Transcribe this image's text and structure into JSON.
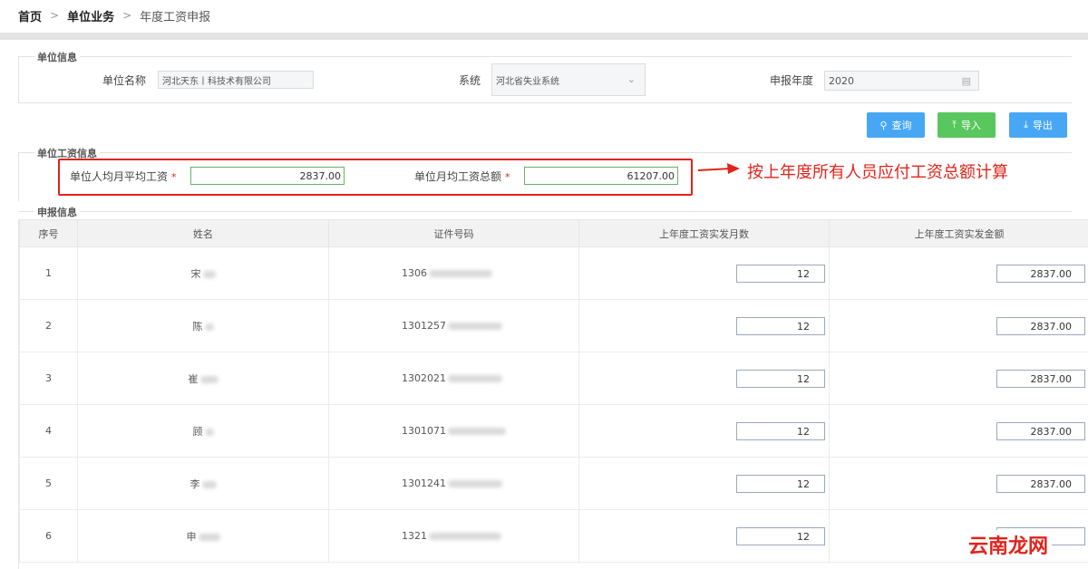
{
  "breadcrumb": {
    "home": "首页",
    "section": "单位业务",
    "current": "年度工资申报",
    "separator": ">"
  },
  "unit_info": {
    "title": "单位信息",
    "name_label": "单位名称",
    "name_value": "河北天东丨科技术有限公司",
    "system_label": "系统",
    "system_value": "河北省失业系统",
    "year_label": "申报年度",
    "year_value": "2020"
  },
  "toolbar": {
    "query_label": "查询",
    "import_label": "导入",
    "export_label": "导出",
    "colors": {
      "query": "#47a7f5",
      "import": "#58c75d",
      "export": "#47a7f5"
    }
  },
  "wage_info": {
    "title": "单位工资信息",
    "avg_label": "单位人均月平均工资",
    "avg_value": "2837.00",
    "total_label": "单位月均工资总额",
    "total_value": "61207.00",
    "required_mark": "*",
    "annotation": "按上年度所有人员应付工资总额计算",
    "annotation_color": "#e2231a"
  },
  "report_info": {
    "title": "申报信息",
    "columns": [
      "序号",
      "姓名",
      "证件号码",
      "上年度工资实发月数",
      "上年度工资实发金额"
    ],
    "rows": [
      {
        "no": "1",
        "name": "宋",
        "id": "1306",
        "months": "12",
        "amount": "2837.00"
      },
      {
        "no": "2",
        "name": "陈",
        "id": "1301257",
        "months": "12",
        "amount": "2837.00"
      },
      {
        "no": "3",
        "name": "崔",
        "id": "1302021",
        "months": "12",
        "amount": "2837.00"
      },
      {
        "no": "4",
        "name": "顾",
        "id": "1301071",
        "months": "12",
        "amount": "2837.00"
      },
      {
        "no": "5",
        "name": "李",
        "id": "1301241",
        "months": "12",
        "amount": "2837.00"
      },
      {
        "no": "6",
        "name": "申",
        "id": "1321",
        "months": "12",
        "amount": ""
      }
    ]
  },
  "watermark": "云南龙网"
}
